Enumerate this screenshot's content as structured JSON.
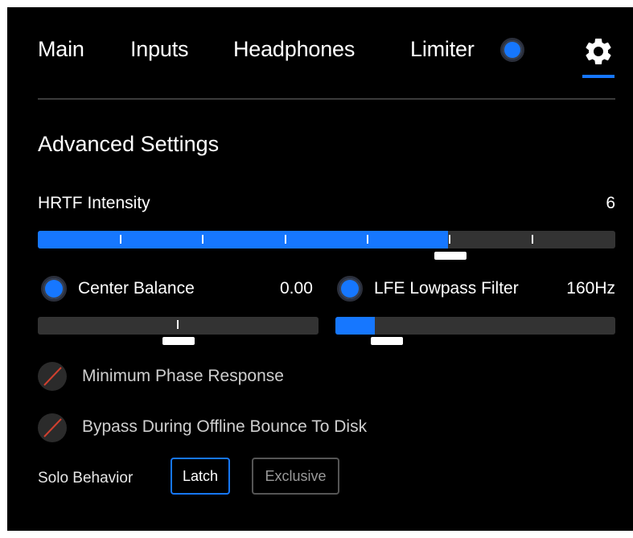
{
  "tabs": {
    "main": "Main",
    "inputs": "Inputs",
    "headphones": "Headphones",
    "limiter": "Limiter"
  },
  "icons": {
    "limiter_toggle": "blue-circle-toggle",
    "settings": "gear-icon"
  },
  "colors": {
    "accent": "#1677ff",
    "background": "#000000",
    "track": "#333333"
  },
  "section": {
    "title": "Advanced Settings"
  },
  "hrtf": {
    "label": "HRTF Intensity",
    "value": "6",
    "fill_fraction": 0.71
  },
  "center_balance": {
    "label": "Center Balance",
    "value": "0.00"
  },
  "lfe": {
    "label": "LFE Lowpass Filter",
    "value": "160Hz",
    "fill_fraction": 0.14
  },
  "options": {
    "min_phase": "Minimum Phase Response",
    "bypass": "Bypass During Offline Bounce To Disk"
  },
  "solo": {
    "label": "Solo Behavior",
    "latch": "Latch",
    "exclusive": "Exclusive",
    "selected": "Latch"
  }
}
